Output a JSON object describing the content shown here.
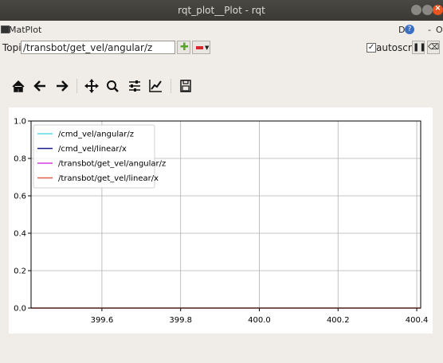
{
  "window": {
    "title": "rqt_plot__Plot - rqt"
  },
  "plugin": {
    "title": "MatPlot",
    "help_label": "D",
    "minimize_label": "-",
    "close_label": "O"
  },
  "topic": {
    "label": "Topic",
    "value": "/transbot/get_vel/angular/z",
    "autoscroll_label": "autoscroll",
    "autoscroll_checked": true
  },
  "toolbar": {
    "icons": [
      "home-icon",
      "back-icon",
      "forward-icon",
      "pan-icon",
      "zoom-icon",
      "configure-subplots-icon",
      "edit-axis-icon",
      "save-icon"
    ]
  },
  "chart_data": {
    "type": "line",
    "title": "",
    "xlabel": "",
    "ylabel": "",
    "xlim": [
      399.42,
      400.41
    ],
    "ylim": [
      0.0,
      1.0
    ],
    "x_ticks": [
      "399.6",
      "399.8",
      "400.0",
      "400.2",
      "400.4"
    ],
    "y_ticks": [
      "0.0",
      "0.2",
      "0.4",
      "0.6",
      "0.8",
      "1.0"
    ],
    "grid": true,
    "legend_position": "upper-left",
    "series": [
      {
        "name": "/cmd_vel/angular/z",
        "color": "#5ad7ea",
        "x": [],
        "y": []
      },
      {
        "name": "/cmd_vel/linear/x",
        "color": "#1a1f8c",
        "x": [],
        "y": []
      },
      {
        "name": "/transbot/get_vel/angular/z",
        "color": "#d43ee0",
        "x": [],
        "y": []
      },
      {
        "name": "/transbot/get_vel/linear/x",
        "color": "#e35a4a",
        "x": [
          399.42,
          400.41
        ],
        "y": [
          0.0,
          0.0
        ]
      }
    ]
  }
}
